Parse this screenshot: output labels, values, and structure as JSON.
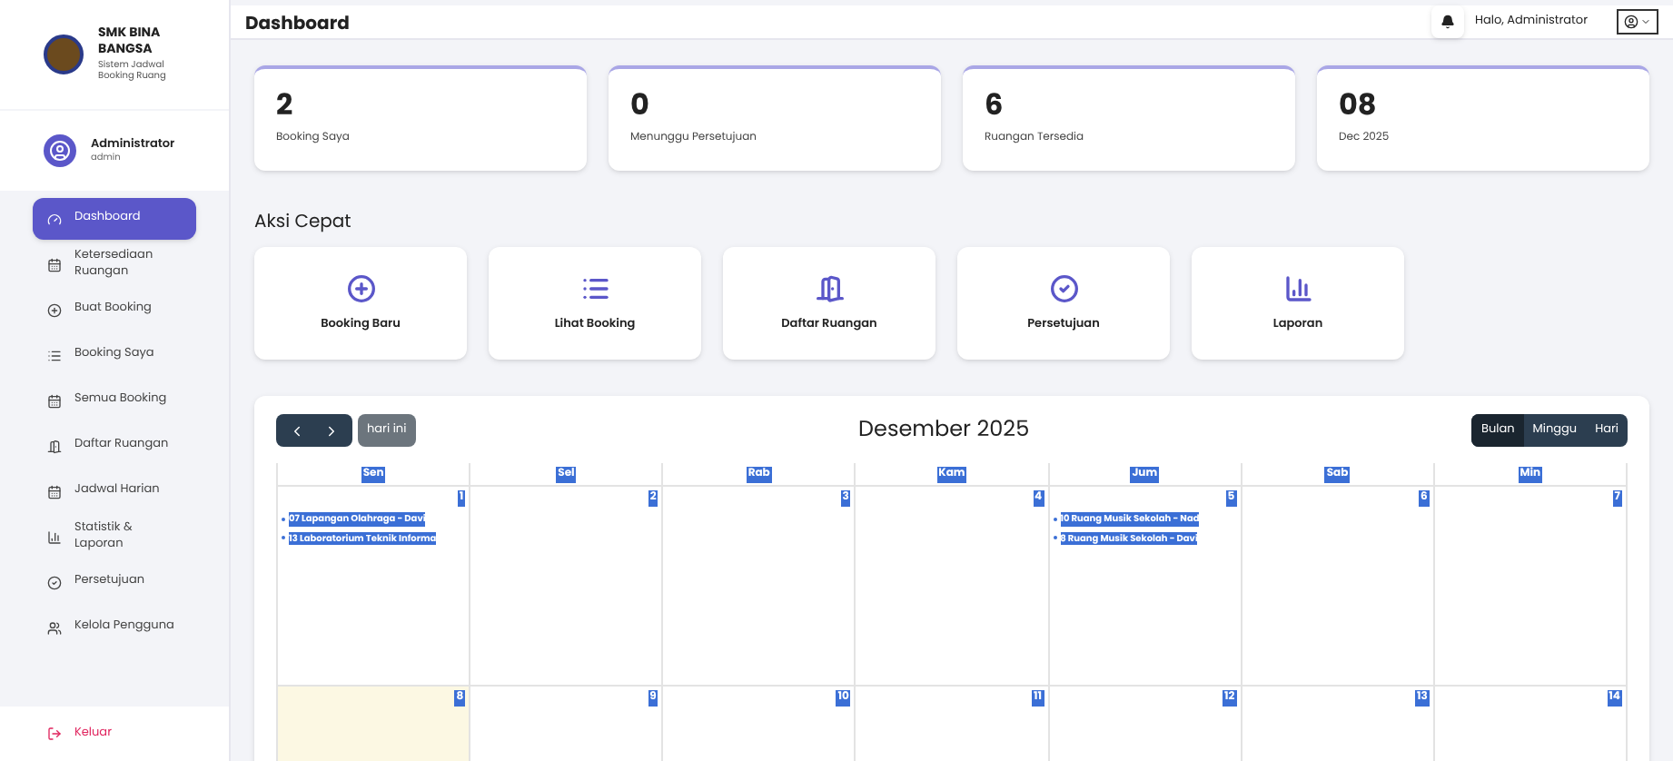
{
  "brand": {
    "name": "SMK BINA BANGSA",
    "subtitle": "Sistem Jadwal Booking Ruang"
  },
  "user": {
    "name": "Administrator",
    "role": "admin"
  },
  "sidebar": {
    "items": [
      {
        "label": "Dashboard",
        "selected": true
      },
      {
        "label": "Ketersediaan Ruangan",
        "selected": false
      },
      {
        "label": "Buat Booking",
        "selected": false
      },
      {
        "label": "Booking Saya",
        "selected": false
      },
      {
        "label": "Semua Booking",
        "selected": false
      },
      {
        "label": "Daftar Ruangan",
        "selected": false
      },
      {
        "label": "Jadwal Harian",
        "selected": false
      },
      {
        "label": "Statistik & Laporan",
        "selected": false
      },
      {
        "label": "Persetujuan",
        "selected": false
      },
      {
        "label": "Kelola Pengguna",
        "selected": false
      }
    ],
    "logout": {
      "label": "Keluar"
    }
  },
  "header": {
    "title": "Dashboard",
    "greeting": "Halo, Administrator"
  },
  "stats": [
    {
      "value": "2",
      "label": "Booking Saya"
    },
    {
      "value": "0",
      "label": "Menunggu Persetujuan"
    },
    {
      "value": "6",
      "label": "Ruangan Tersedia"
    },
    {
      "value": "08",
      "label": "Dec 2025"
    }
  ],
  "quick_actions": {
    "title": "Aksi Cepat",
    "items": [
      {
        "label": "Booking Baru"
      },
      {
        "label": "Lihat Booking"
      },
      {
        "label": "Daftar Ruangan"
      },
      {
        "label": "Persetujuan"
      },
      {
        "label": "Laporan"
      }
    ]
  },
  "calendar": {
    "title": "Desember 2025",
    "today_button": "hari ini",
    "views": [
      {
        "label": "Bulan",
        "selected": true
      },
      {
        "label": "Minggu",
        "selected": false
      },
      {
        "label": "Hari",
        "selected": false
      }
    ],
    "weekdays": [
      "Sen",
      "Sel",
      "Rab",
      "Kam",
      "Jum",
      "Sab",
      "Min"
    ],
    "weeks": [
      [
        {
          "date": "1",
          "today": false,
          "events": [
            "07 Lapangan Olahraga - Davi",
            "13 Laboratorium Teknik Informa"
          ]
        },
        {
          "date": "2",
          "today": false
        },
        {
          "date": "3",
          "today": false
        },
        {
          "date": "4",
          "today": false
        },
        {
          "date": "5",
          "today": false,
          "events": [
            "10 Ruang Musik Sekolah - Nad",
            "8 Ruang Musik Sekolah - Davi"
          ]
        },
        {
          "date": "6",
          "today": false
        },
        {
          "date": "7",
          "today": false
        }
      ],
      [
        {
          "date": "8",
          "today": true
        },
        {
          "date": "9",
          "today": false
        },
        {
          "date": "10",
          "today": false
        },
        {
          "date": "11",
          "today": false
        },
        {
          "date": "12",
          "today": false
        },
        {
          "date": "13",
          "today": false
        },
        {
          "date": "14",
          "today": false
        }
      ]
    ]
  }
}
